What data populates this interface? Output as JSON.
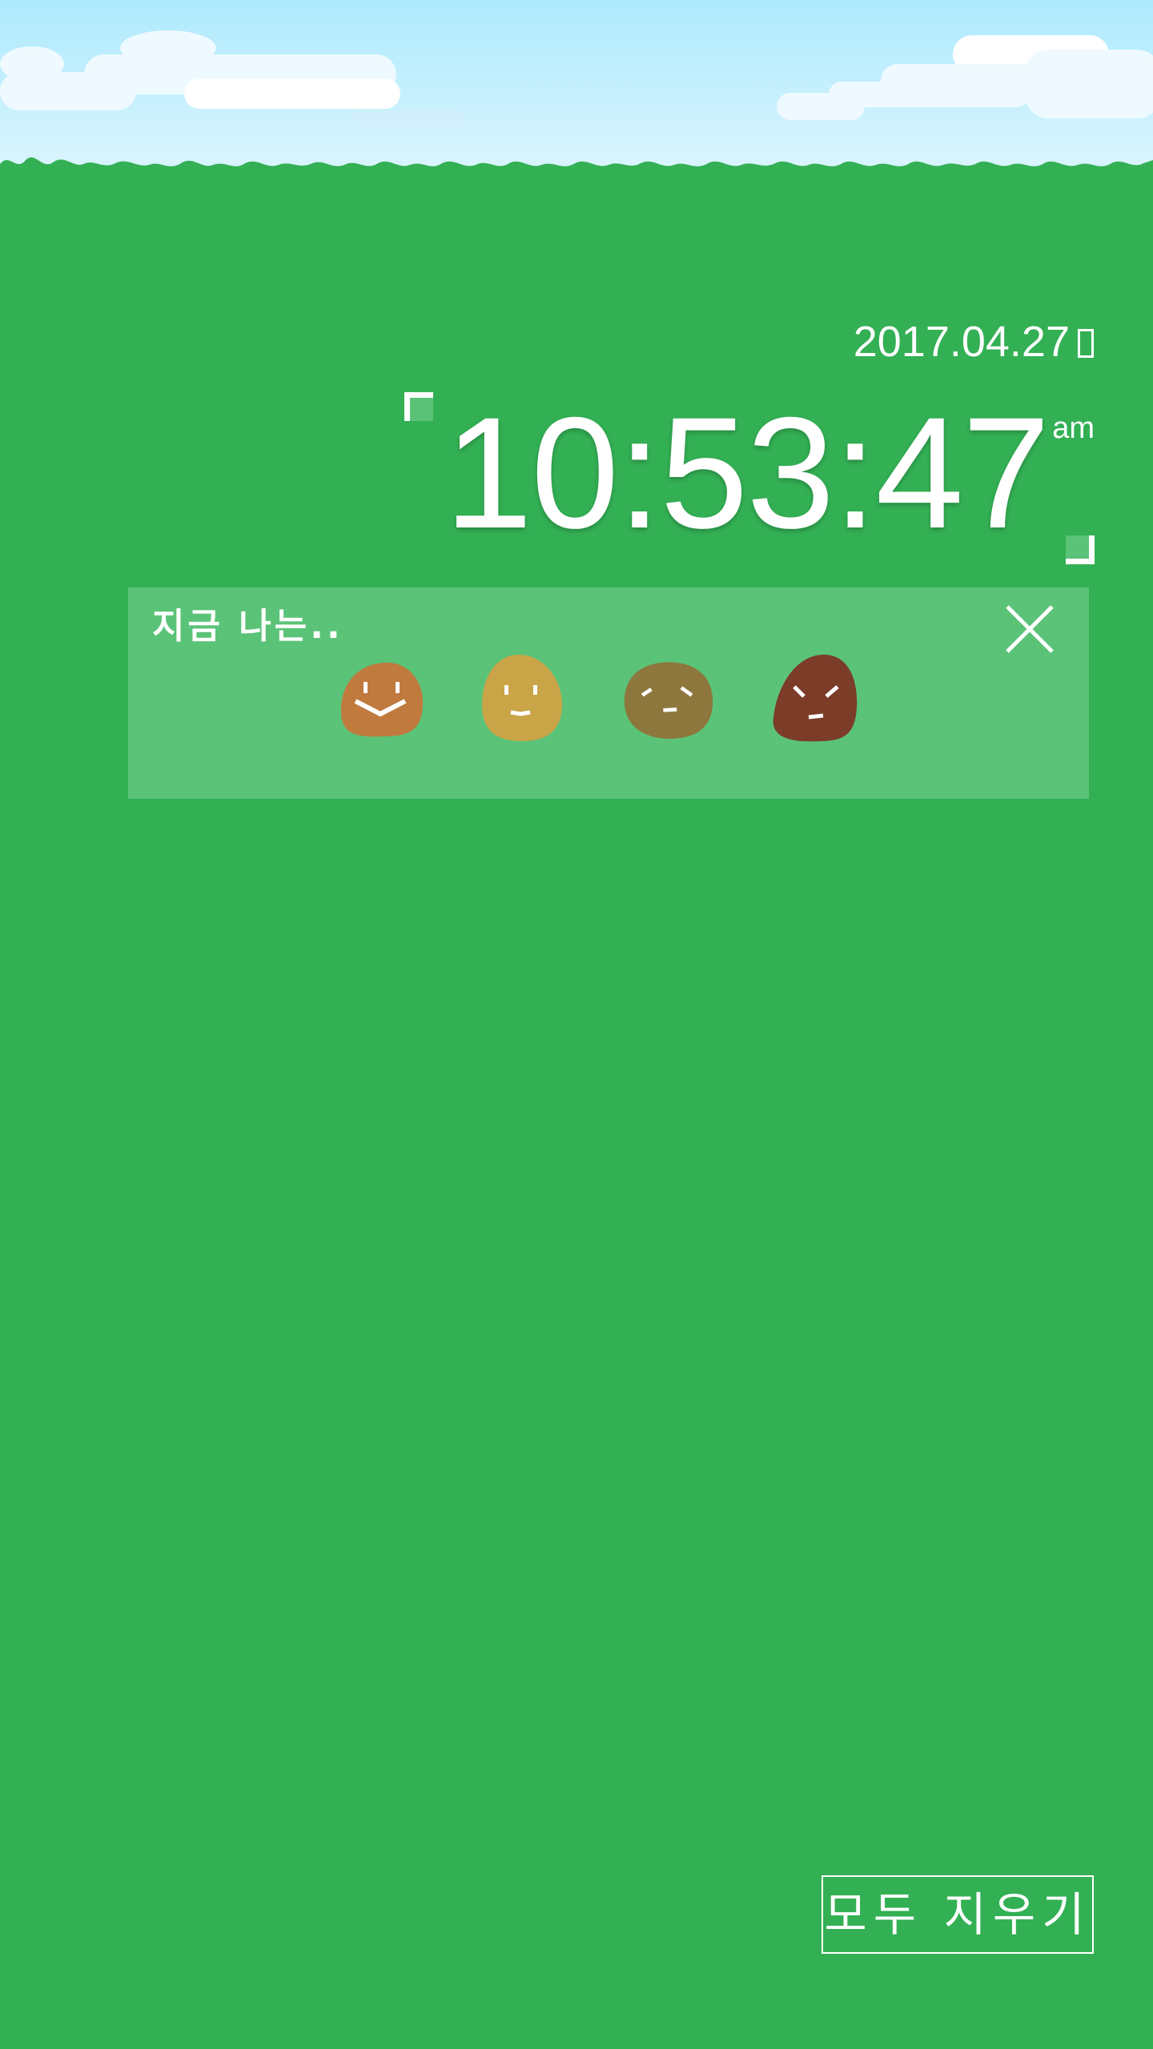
{
  "header": {
    "date_text": "2017.04.27",
    "day_glyph": "missing-glyph-box"
  },
  "clock": {
    "time": "10:53:47",
    "ampm": "am"
  },
  "mood_panel": {
    "title": "지금 나는..",
    "close_icon": "close-x-icon",
    "moods": [
      {
        "name": "happy",
        "color": "#c07a3e"
      },
      {
        "name": "content",
        "color": "#c9a548"
      },
      {
        "name": "meh",
        "color": "#8d773d"
      },
      {
        "name": "angry",
        "color": "#7b3d28"
      }
    ]
  },
  "footer": {
    "clear_all_label": "모두 지우기"
  },
  "colors": {
    "background": "#33b054",
    "panel": "#5bc378",
    "sky_top": "#aeeaff",
    "sky_bottom": "#dff6ff",
    "text": "#ffffff"
  }
}
